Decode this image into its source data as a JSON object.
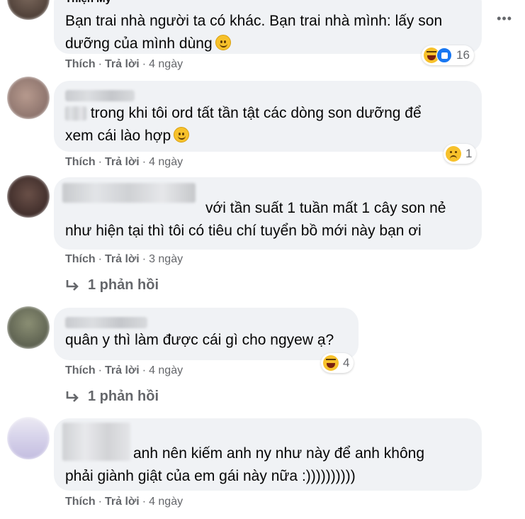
{
  "comments": [
    {
      "name": "Thiện My",
      "line1": "Bạn trai nhà người ta có khác. Bạn trai nhà mình: lấy son",
      "line2": "dưỡng của mình dùng",
      "like": "Thích",
      "reply": "Trả lời",
      "time": "4 ngày",
      "reaction_count": "16"
    },
    {
      "line1": "trong khi tôi ord tất tần tật các dòng son dưỡng để",
      "line2": "xem cái lào hợp",
      "like": "Thích",
      "reply": "Trả lời",
      "time": "4 ngày",
      "reaction_count": "1"
    },
    {
      "line1": "với tần suất 1 tuần mất 1 cây son nẻ",
      "line2": "như hiện tại thì tôi có tiêu chí tuyển bồ mới này bạn ơi",
      "like": "Thích",
      "reply": "Trả lời",
      "time": "3 ngày",
      "replies_label": "1 phản hồi"
    },
    {
      "line1": "quân y thì làm được cái gì cho ngyew ạ?",
      "like": "Thích",
      "reply": "Trả lời",
      "time": "4 ngày",
      "reaction_count": "4",
      "replies_label": "1 phản hồi"
    },
    {
      "line1": "anh nên kiếm anh ny như này để anh không",
      "line2": "phải giành giật của em gái này nữa :))))))))))",
      "like": "Thích",
      "reply": "Trả lời",
      "time": "4 ngày"
    }
  ],
  "icons": {
    "more": "more-options-icon",
    "haha": "haha-reaction-icon",
    "like": "like-reaction-icon",
    "sad": "sad-reaction-icon",
    "smile": "smile-emoji-icon",
    "reply_arrow": "reply-arrow-icon"
  },
  "colors": {
    "bubble": "#f0f2f5",
    "meta_text": "#65676b",
    "like_blue": "#1877f2",
    "emoji_yellow": "#f7c12b"
  }
}
